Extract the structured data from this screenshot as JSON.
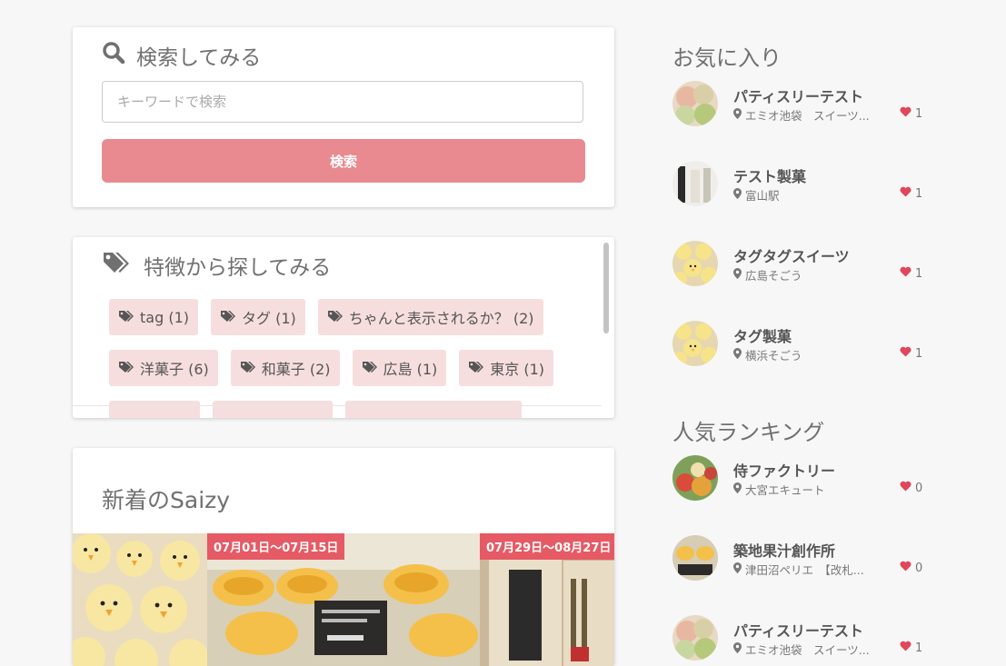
{
  "search": {
    "title": "検索してみる",
    "placeholder": "キーワードで検索",
    "button": "検索"
  },
  "features": {
    "title": "特徴から探してみる",
    "tags": [
      {
        "label": "tag (1)"
      },
      {
        "label": "タグ (1)"
      },
      {
        "label": "ちゃんと表示されるか？ (2)"
      },
      {
        "label": "洋菓子 (6)"
      },
      {
        "label": "和菓子 (2)"
      },
      {
        "label": "広島 (1)"
      },
      {
        "label": "東京 (1)"
      }
    ]
  },
  "new_items": {
    "title": "新着のSaizy",
    "slides": [
      {
        "date": ""
      },
      {
        "date": "07月01日〜07月15日"
      },
      {
        "date": "07月29日〜08月27日"
      }
    ]
  },
  "favorites": {
    "title": "お気に入り",
    "items": [
      {
        "name": "パティスリーテスト",
        "location": "エミオ池袋　スイーツ...",
        "likes": "1",
        "image": "macaron-image"
      },
      {
        "name": "テスト製菓",
        "location": "富山駅",
        "likes": "1",
        "image": "bottle-image"
      },
      {
        "name": "タグタグスイーツ",
        "location": "広島そごう",
        "likes": "1",
        "image": "chick-image"
      },
      {
        "name": "タグ製菓",
        "location": "横浜そごう",
        "likes": "1",
        "image": "chick-image"
      }
    ]
  },
  "ranking": {
    "title": "人気ランキング",
    "items": [
      {
        "name": "侍ファクトリー",
        "location": "大宮エキュート",
        "likes": "0",
        "image": "fruit-candy-image"
      },
      {
        "name": "築地果汁創作所",
        "location": "津田沼ペリエ　【改札...",
        "likes": "0",
        "image": "jelly-image"
      },
      {
        "name": "パティスリーテスト",
        "location": "エミオ池袋　スイーツ...",
        "likes": "1",
        "image": "macaron-image"
      }
    ]
  },
  "colors": {
    "accent": "#e88a8f",
    "date_badge": "#e55a64",
    "heart": "#e0485a",
    "tag_bg": "#f7dede"
  }
}
